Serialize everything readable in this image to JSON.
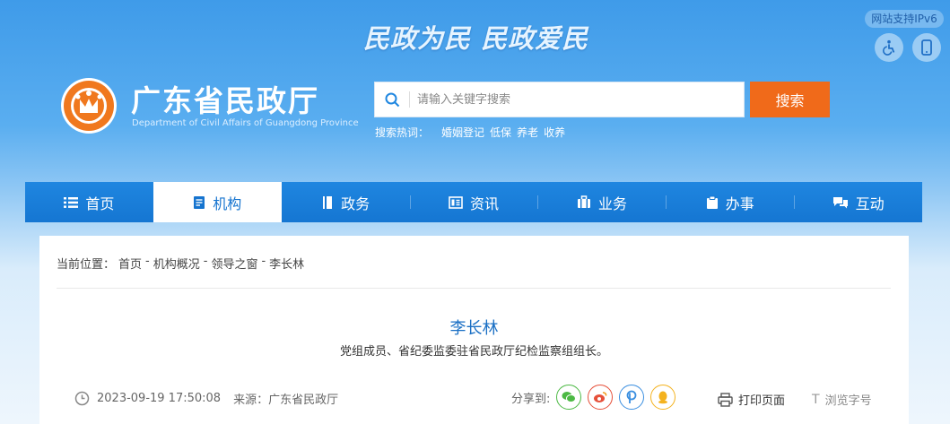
{
  "header": {
    "slogan": "民政为民  民政爱民",
    "ipv6_badge": "网站支持IPv6",
    "site_name": "广东省民政厅",
    "site_name_en": "Department of Civil Affairs of Guangdong Province",
    "accessibility_icon": "wheelchair-icon",
    "mobile_icon": "mobile-icon"
  },
  "search": {
    "placeholder": "请输入关键字搜索",
    "button_label": "搜索",
    "hot_label": "搜索热词：",
    "hot_words": [
      "婚姻登记",
      "低保",
      "养老",
      "收养"
    ]
  },
  "nav": {
    "items": [
      {
        "label": "首页",
        "icon": "list-icon"
      },
      {
        "label": "机构",
        "icon": "document-icon",
        "active": true
      },
      {
        "label": "政务",
        "icon": "book-icon"
      },
      {
        "label": "资讯",
        "icon": "news-icon"
      },
      {
        "label": "业务",
        "icon": "briefcase-icon"
      },
      {
        "label": "办事",
        "icon": "clipboard-icon"
      },
      {
        "label": "互动",
        "icon": "chat-icon"
      }
    ]
  },
  "breadcrumb": {
    "prefix": "当前位置：",
    "items": [
      "首页",
      "机构概况",
      "领导之窗",
      "李长林"
    ],
    "separator": "-"
  },
  "article": {
    "title": "李长林",
    "subtitle": "党组成员、省纪委监委驻省民政厅纪检监察组组长。",
    "datetime": "2023-09-19 17:50:08",
    "source": "来源：广东省民政厅"
  },
  "share": {
    "label": "分享到:",
    "targets": [
      "wechat-icon",
      "weibo-icon",
      "pin-icon",
      "qq-icon"
    ]
  },
  "tools": {
    "print_label": "打印页面",
    "font_label": "浏览字号"
  },
  "colors": {
    "nav_blue": "#1576d2",
    "search_orange": "#f06a1a",
    "title_blue": "#1a6fc4"
  }
}
